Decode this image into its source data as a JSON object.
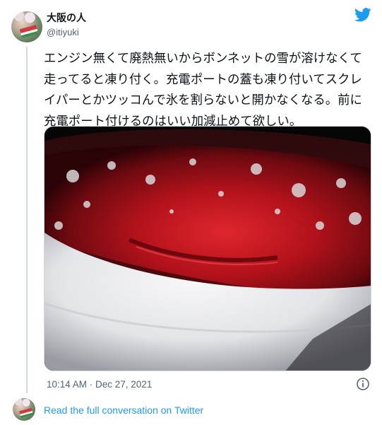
{
  "author": {
    "display_name": "大阪の人",
    "handle": "@itiyuki"
  },
  "tweet": {
    "text": "エンジン無くて廃熱無いからボンネットの雪が溶けなくて走ってると凍り付く。充電ポートの蓋も凍り付いてスクレイパーとかツッコんで氷を割らないと開かなくなる。前に充電ポート付けるのはいい加減止めて欲しい。",
    "timestamp": "10:14 AM · Dec 27, 2021"
  },
  "footer": {
    "read_link": "Read the full conversation on Twitter"
  },
  "icons": {
    "brand": "twitter-bird-icon",
    "info": "info-icon"
  },
  "colors": {
    "twitter_blue": "#1d9bf0",
    "secondary_text": "#536471",
    "car_red": "#b3121b"
  }
}
